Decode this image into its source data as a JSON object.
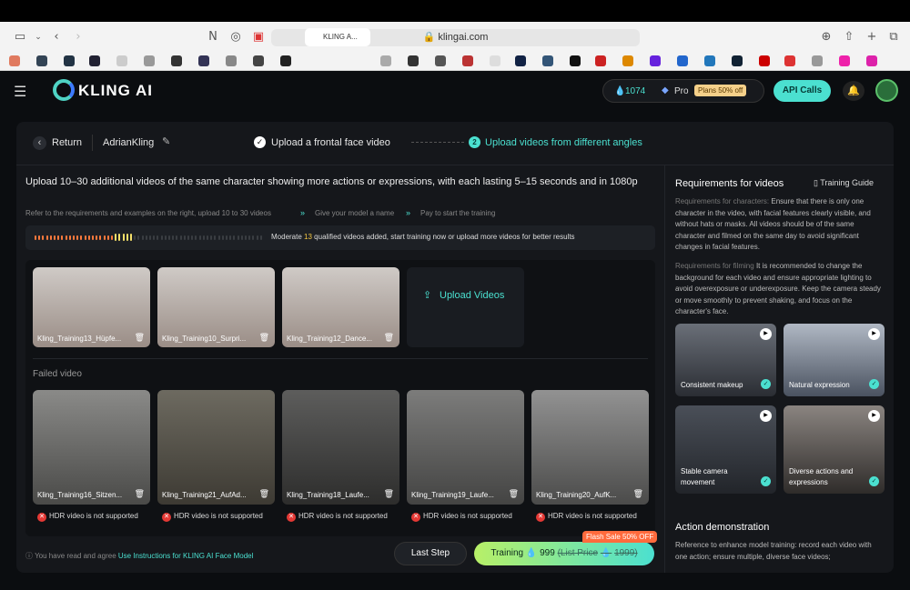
{
  "browser": {
    "url": "klingai.com",
    "tab_title": "KLING A..."
  },
  "nav": {
    "logo_text": "KLING AI",
    "credits": "1074",
    "plan": "Pro",
    "plans_badge": "Plans 50% off",
    "api_button": "API Calls"
  },
  "header": {
    "return": "Return",
    "username": "AdrianKling",
    "step1": "Upload a frontal face video",
    "step2_num": "2",
    "step2": "Upload videos from different angles"
  },
  "main": {
    "instruction": "Upload 10–30 additional videos of the same character showing more actions or expressions, with each lasting 5–15 seconds and in 1080p",
    "steps": [
      "Refer to the requirements and examples on the right, upload 10 to 30 videos",
      "Give your model a name",
      "Pay to start the training"
    ],
    "progress_prefix": "Moderate",
    "progress_count": "13",
    "progress_suffix": "qualified videos added, start training now or upload more videos for better results",
    "progress_fraction": 0.43,
    "uploaded": [
      {
        "label": "Kling_Training13_Hüpfe..."
      },
      {
        "label": "Kling_Training10_Surpri..."
      },
      {
        "label": "Kling_Training12_Dance..."
      }
    ],
    "upload_button": "Upload Videos",
    "failed_title": "Failed video",
    "failed": [
      {
        "label": "Kling_Training16_Sitzen...",
        "error": "HDR video is not supported"
      },
      {
        "label": "Kling_Training21_AufAd...",
        "error": "HDR video is not supported"
      },
      {
        "label": "Kling_Training18_Laufe...",
        "error": "HDR video is not supported"
      },
      {
        "label": "Kling_Training19_Laufe...",
        "error": "HDR video is not supported"
      },
      {
        "label": "Kling_Training20_AufK...",
        "error": "HDR video is not supported"
      }
    ],
    "agree_text": "You have read and agree",
    "agree_link": "Use Instructions for KLING AI Face Model",
    "last_step": "Last Step",
    "training_label": "Training",
    "training_price": "999",
    "list_price_label": "(List Price",
    "list_price": "1999)",
    "flash_sale": "Flash Sale 50% OFF"
  },
  "right": {
    "title": "Requirements for videos",
    "guide": "Training Guide",
    "char_label": "Requirements for characters:",
    "char_text": "Ensure that there is only one character in the video, with facial features clearly visible, and without hats or masks. All videos should be of the same character and filmed on the same day to avoid significant changes in facial features.",
    "film_label": "Requirements for filming",
    "film_text": "It is recommended to change the background for each video and ensure appropriate lighting to avoid overexposure or underexposure. Keep the camera steady or move smoothly to prevent shaking, and focus on the character's face.",
    "examples": [
      {
        "label": "Consistent makeup"
      },
      {
        "label": "Natural expression"
      },
      {
        "label": "Stable camera movement"
      },
      {
        "label": "Diverse actions and expressions"
      }
    ],
    "action_title": "Action demonstration",
    "action_text": "Reference to enhance model training: record each video with one action; ensure multiple, diverse face videos;"
  },
  "colors": {
    "accent": "#4be0d0",
    "error": "#e53935",
    "bg": "#0b0d10",
    "card": "#15171b"
  }
}
